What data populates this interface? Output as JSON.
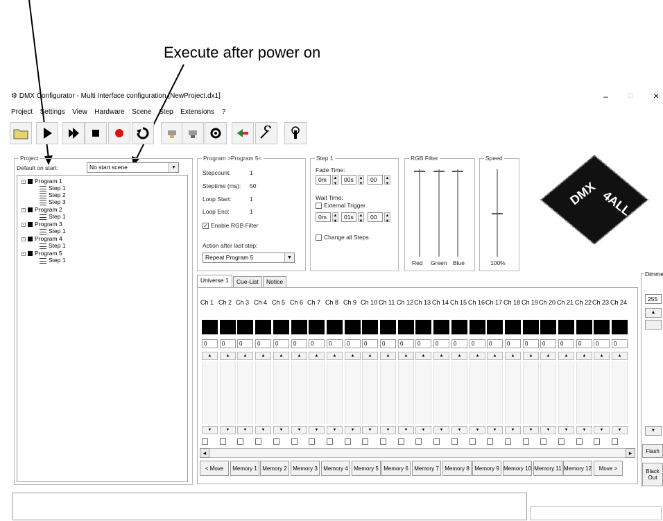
{
  "annotations": {
    "execute_after_power_on": "Execute after power on"
  },
  "window": {
    "title": "DMX Configurator - Multi Interface configuration [NewProject.dx1]",
    "controls": {
      "minimize": "–",
      "maximize": "□",
      "close": "×"
    }
  },
  "menu": [
    "Project",
    "Settings",
    "View",
    "Hardware",
    "Scene",
    "Step",
    "Extensions",
    "?"
  ],
  "toolbar": [
    {
      "icon": "open-folder-icon"
    },
    {
      "icon": "play-icon"
    },
    {
      "icon": "step-play-icon"
    },
    {
      "icon": "stop-icon"
    },
    {
      "icon": "record-icon"
    },
    {
      "icon": "repeat-icon"
    },
    {
      "icon": "lamp-icon"
    },
    {
      "icon": "lamp-off-icon"
    },
    {
      "icon": "gear-icon"
    },
    {
      "icon": "import-icon"
    },
    {
      "icon": "wrench-icon"
    },
    {
      "icon": "touch-icon"
    }
  ],
  "project": {
    "group_label": "Project",
    "default_on_start_label": "Default on start:",
    "start_scene_value": "No start scene",
    "tree": [
      {
        "program": "Program 1",
        "steps": [
          "Step 1",
          "Step 2",
          "Step 3"
        ]
      },
      {
        "program": "Program 2",
        "steps": [
          "Step 1"
        ]
      },
      {
        "program": "Program 3",
        "steps": [
          "Step 1"
        ]
      },
      {
        "program": "Program 4",
        "steps": [
          "Step 1"
        ]
      },
      {
        "program": "Program 5",
        "steps": [
          "Step 1"
        ]
      }
    ]
  },
  "program_info": {
    "group_label": "Program >Program 5<",
    "stepcount_label": "Stepcount:",
    "stepcount": "1",
    "steptime_label": "Steptime (ms):",
    "steptime": "50",
    "loop_start_label": "Loop Start:",
    "loop_start": "1",
    "loop_end_label": "Loop End:",
    "loop_end": "1",
    "enable_rgb_label": "Enable RGB Filter",
    "enable_rgb_checked": "✓",
    "action_label": "Action after last step:",
    "action_value": "Repeat Program 5"
  },
  "step": {
    "group_label": "Step 1",
    "fade_label": "Fade Time:",
    "fade": {
      "m": "0m",
      "s": "00s",
      "f": "00"
    },
    "wait_label": "Wait Time:",
    "external_trigger_label": "External Trigger",
    "wait": {
      "m": "0m",
      "s": "01s",
      "f": "00"
    },
    "change_all_label": "Change all Steps",
    "spin_up": "▲",
    "spin_down": "▼"
  },
  "rgb_filter": {
    "group_label": "RGB Filter",
    "red": "Red",
    "green": "Green",
    "blue": "Blue"
  },
  "speed": {
    "group_label": "Speed",
    "value": "100%"
  },
  "logo": {
    "text_left": "DMX",
    "text_right": "4ALL"
  },
  "tabs": [
    "Universe 1",
    "Cue-List",
    "Notice"
  ],
  "channels": [
    {
      "name": "Ch 1",
      "value": "0"
    },
    {
      "name": "Ch 2",
      "value": "0"
    },
    {
      "name": "Ch 3",
      "value": "0"
    },
    {
      "name": "Ch 4",
      "value": "0"
    },
    {
      "name": "Ch 5",
      "value": "0"
    },
    {
      "name": "Ch 6",
      "value": "0"
    },
    {
      "name": "Ch 7",
      "value": "0"
    },
    {
      "name": "Ch 8",
      "value": "0"
    },
    {
      "name": "Ch 9",
      "value": "0"
    },
    {
      "name": "Ch 10",
      "value": "0"
    },
    {
      "name": "Ch 11",
      "value": "0"
    },
    {
      "name": "Ch 12",
      "value": "0"
    },
    {
      "name": "Ch 13",
      "value": "0"
    },
    {
      "name": "Ch 14",
      "value": "0"
    },
    {
      "name": "Ch 15",
      "value": "0"
    },
    {
      "name": "Ch 16",
      "value": "0"
    },
    {
      "name": "Ch 17",
      "value": "0"
    },
    {
      "name": "Ch 18",
      "value": "0"
    },
    {
      "name": "Ch 19",
      "value": "0"
    },
    {
      "name": "Ch 20",
      "value": "0"
    },
    {
      "name": "Ch 21",
      "value": "0"
    },
    {
      "name": "Ch 22",
      "value": "0"
    },
    {
      "name": "Ch 23",
      "value": "0"
    },
    {
      "name": "Ch 24",
      "value": "0"
    }
  ],
  "scroll": {
    "left": "◂",
    "right": "▸"
  },
  "memory_buttons": [
    "< Move",
    "Memory 1",
    "Memory 2",
    "Memory 3",
    "Memory 4",
    "Memory 5",
    "Memory 6",
    "Memory 7",
    "Memory 8",
    "Memory 9",
    "Memory 10",
    "Memory 11",
    "Memory 12",
    "Move >"
  ],
  "dimmer": {
    "label": "Dimmer",
    "value": "255",
    "flash": "Flash",
    "blackout": "Black Out"
  }
}
